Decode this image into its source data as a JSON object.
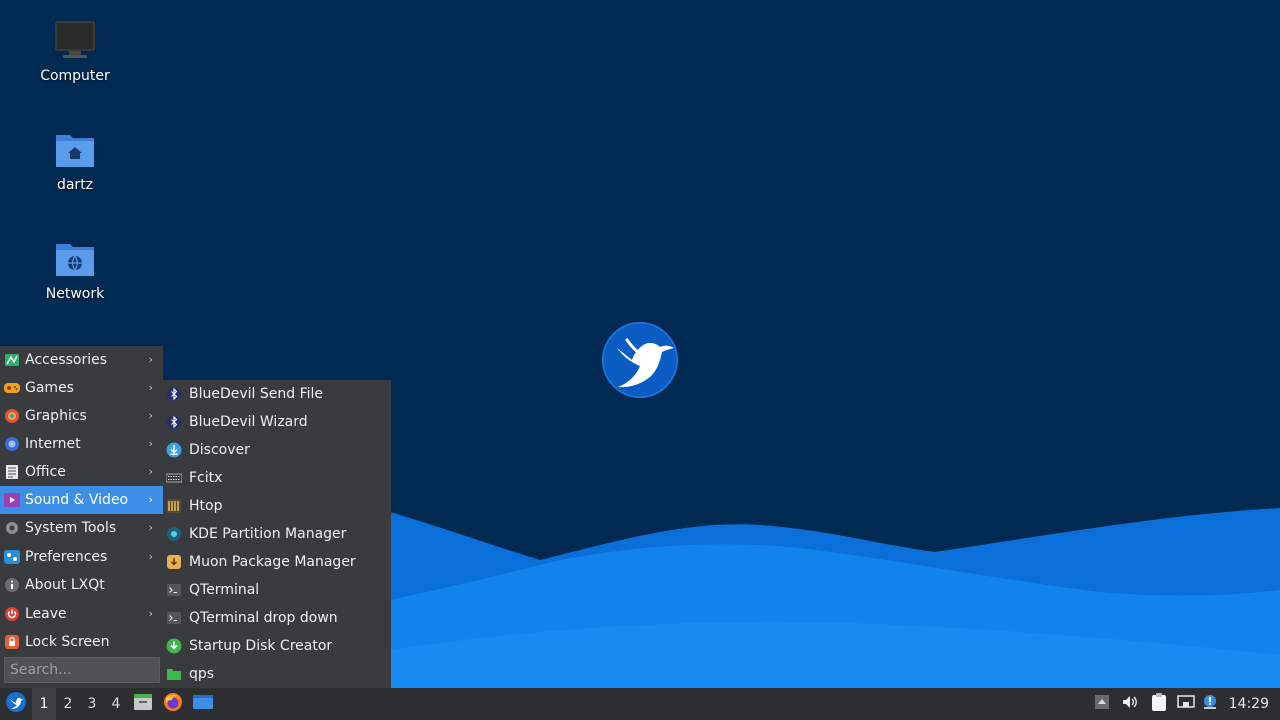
{
  "desktop": {
    "icons": [
      {
        "label": "Computer",
        "icon": "computer-icon"
      },
      {
        "label": "dartz",
        "icon": "home-folder-icon"
      },
      {
        "label": "Network",
        "icon": "network-folder-icon"
      }
    ]
  },
  "menu": {
    "items": [
      {
        "label": "Accessories",
        "icon": "accessories-icon",
        "submenu": true
      },
      {
        "label": "Games",
        "icon": "games-icon",
        "submenu": true
      },
      {
        "label": "Graphics",
        "icon": "graphics-icon",
        "submenu": true
      },
      {
        "label": "Internet",
        "icon": "internet-icon",
        "submenu": true
      },
      {
        "label": "Office",
        "icon": "office-icon",
        "submenu": true
      },
      {
        "label": "Sound & Video",
        "icon": "sound-video-icon",
        "submenu": true,
        "selected": true
      },
      {
        "label": "System Tools",
        "icon": "system-tools-icon",
        "submenu": true
      },
      {
        "label": "Preferences",
        "icon": "preferences-icon",
        "submenu": true
      },
      {
        "label": "About LXQt",
        "icon": "info-icon",
        "submenu": false
      },
      {
        "label": "Leave",
        "icon": "power-icon",
        "submenu": true
      },
      {
        "label": "Lock Screen",
        "icon": "lock-icon",
        "submenu": false
      }
    ],
    "search_placeholder": "Search..."
  },
  "submenu": {
    "items": [
      {
        "label": "BlueDevil Send File",
        "icon": "bluetooth-icon"
      },
      {
        "label": "BlueDevil Wizard",
        "icon": "bluetooth-icon"
      },
      {
        "label": "Discover",
        "icon": "discover-icon"
      },
      {
        "label": "Fcitx",
        "icon": "keyboard-icon"
      },
      {
        "label": "Htop",
        "icon": "htop-icon"
      },
      {
        "label": "KDE Partition Manager",
        "icon": "partition-icon"
      },
      {
        "label": "Muon Package Manager",
        "icon": "package-icon"
      },
      {
        "label": "QTerminal",
        "icon": "terminal-icon"
      },
      {
        "label": "QTerminal drop down",
        "icon": "terminal-icon"
      },
      {
        "label": "Startup Disk Creator",
        "icon": "usb-creator-icon"
      },
      {
        "label": "qps",
        "icon": "qps-icon"
      }
    ]
  },
  "taskbar": {
    "workspaces": [
      "1",
      "2",
      "3",
      "4"
    ],
    "active_workspace": "1",
    "clock": "14:29"
  },
  "colors": {
    "wallpaper_dark": "#002a52",
    "wave_light": "#1e90ff",
    "accent": "#3d8ee6",
    "menu_bg": "#3a3b3f",
    "taskbar_bg": "#2d2e31"
  }
}
